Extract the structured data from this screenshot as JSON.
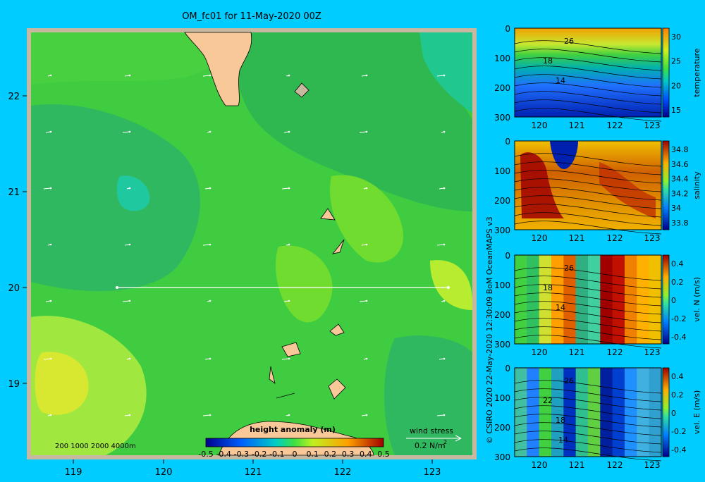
{
  "title": "OM_fc01 for 11-May-2020 00Z",
  "credit": "© CSIRO 2020  22-May-2020 12:30:09 BoM OceanMAPS v3",
  "map": {
    "lon_ticks": [
      "119",
      "120",
      "121",
      "122",
      "123"
    ],
    "lat_ticks": [
      "22",
      "21",
      "20",
      "19"
    ],
    "bathy_legend": "200  1000  2000  4000m",
    "colorbar": {
      "title": "height anomaly  (m)",
      "tick_labels": [
        "-0.5",
        "-0.4",
        "-0.3",
        "-0.2",
        "-0.1",
        "0",
        "0.1",
        "0.2",
        "0.3",
        "0.4",
        "0.5"
      ]
    },
    "wind_key": {
      "title": "wind stress",
      "label": "0.2 N/m",
      "superscript": "2"
    },
    "section_line": {
      "lon": [
        119.5,
        123.2
      ],
      "lat": 20.0
    }
  },
  "panels": [
    {
      "id": "temperature",
      "colorbar_label": "temperature",
      "y_ticks": [
        "0",
        "100",
        "200",
        "300"
      ],
      "x_ticks": [
        "120",
        "121",
        "122",
        "123"
      ],
      "cb_ticks": [
        "30",
        "25",
        "20",
        "15"
      ],
      "contour_labels": [
        "26",
        "18",
        "14"
      ]
    },
    {
      "id": "salinity",
      "colorbar_label": "salinity",
      "y_ticks": [
        "0",
        "100",
        "200",
        "300"
      ],
      "x_ticks": [
        "120",
        "121",
        "122",
        "123"
      ],
      "cb_ticks": [
        "34.8",
        "34.6",
        "34.4",
        "34.2",
        "34",
        "33.8"
      ],
      "contour_labels": []
    },
    {
      "id": "vel-n",
      "colorbar_label": "vel. N  (m/s)",
      "y_ticks": [
        "0",
        "100",
        "200",
        "300"
      ],
      "x_ticks": [
        "120",
        "121",
        "122",
        "123"
      ],
      "cb_ticks": [
        "0.4",
        "0.2",
        "0",
        "-0.2",
        "-0.4"
      ],
      "contour_labels": [
        "26",
        "18",
        "14"
      ]
    },
    {
      "id": "vel-e",
      "colorbar_label": "vel. E  (m/s)",
      "y_ticks": [
        "0",
        "100",
        "200",
        "300"
      ],
      "x_ticks": [
        "120",
        "121",
        "122",
        "123"
      ],
      "cb_ticks": [
        "0.4",
        "0.2",
        "0",
        "-0.2",
        "-0.4"
      ],
      "contour_labels": [
        "26",
        "22",
        "18",
        "14"
      ]
    }
  ]
}
